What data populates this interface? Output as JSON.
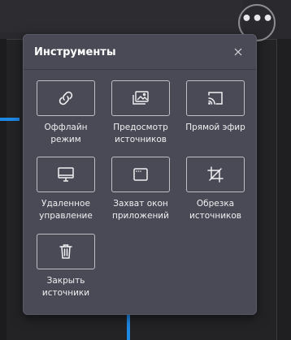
{
  "panel": {
    "title": "Инструменты",
    "close_icon": "close-icon"
  },
  "more_button": {
    "icon": "more-horizontal-icon",
    "glyph": "•••"
  },
  "tools": [
    {
      "label": "Оффлайн\nрежим",
      "icon": "link-icon"
    },
    {
      "label": "Предосмотр\nисточников",
      "icon": "image-gallery-icon"
    },
    {
      "label": "Прямой эфир",
      "icon": "cast-icon"
    },
    {
      "label": "Удаленное\nуправление",
      "icon": "monitor-icon"
    },
    {
      "label": "Захват окон\nприложений",
      "icon": "window-icon"
    },
    {
      "label": "Обрезка\nисточников",
      "icon": "crop-icon"
    },
    {
      "label": "Закрыть\nисточники",
      "icon": "trash-icon"
    }
  ],
  "colors": {
    "accent": "#1e88e5",
    "panel_bg": "#4a4a56",
    "app_bg": "#232326"
  }
}
